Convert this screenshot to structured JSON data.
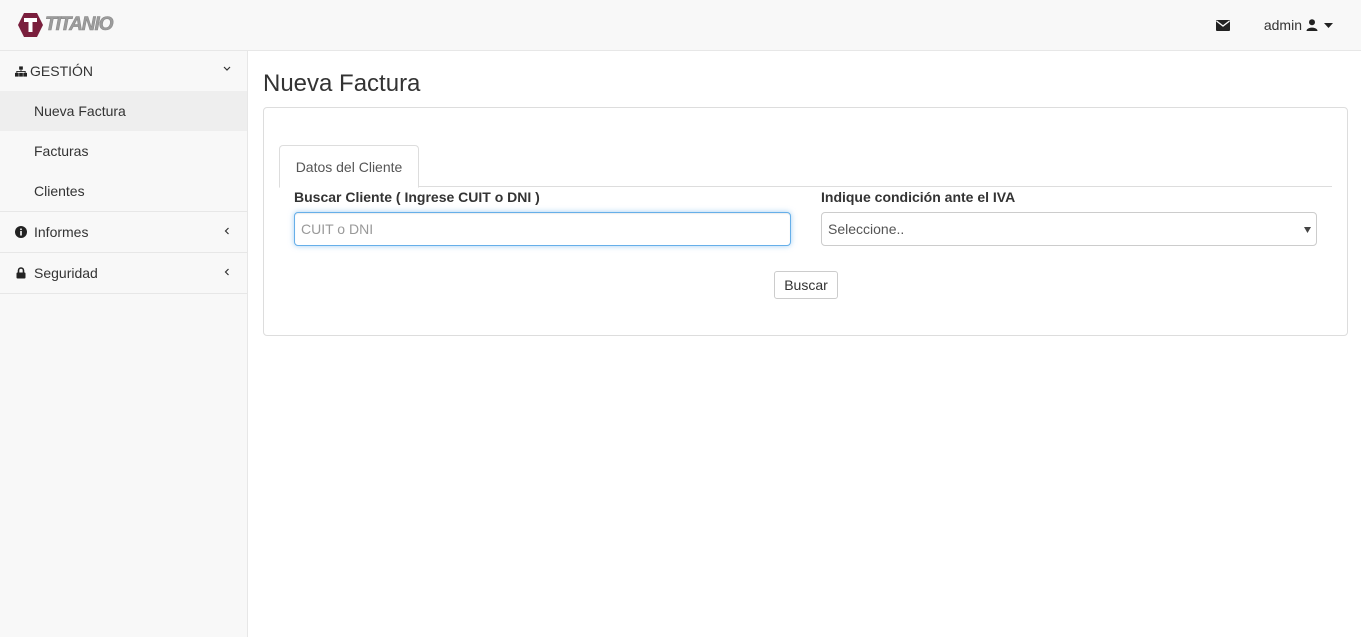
{
  "navbar": {
    "brand_text": "TITANIO",
    "brand_color": "#7a1f3d",
    "mail_icon": "envelope-icon",
    "user_label": "admin",
    "user_icon": "user-icon",
    "dropdown_icon": "caret-down-icon"
  },
  "sidebar": {
    "sections": [
      {
        "label": "GESTIÓN",
        "icon": "sitemap-icon",
        "expanded": true,
        "items": [
          {
            "label": "Nueva Factura",
            "active": true
          },
          {
            "label": "Facturas",
            "active": false
          },
          {
            "label": "Clientes",
            "active": false
          }
        ]
      },
      {
        "label": "Informes",
        "icon": "info-circle-icon",
        "expanded": false
      },
      {
        "label": "Seguridad",
        "icon": "lock-icon",
        "expanded": false
      }
    ]
  },
  "main": {
    "title": "Nueva Factura",
    "tabs": [
      {
        "label": "Datos del Cliente",
        "active": true
      }
    ],
    "cliente_label": "Buscar Cliente ( Ingrese CUIT o DNI )",
    "cliente_placeholder": "CUIT o DNI",
    "cliente_value": "",
    "iva_label": "Indique condición ante el IVA",
    "iva_selected": "Seleccione..",
    "buscar_label": "Buscar"
  }
}
